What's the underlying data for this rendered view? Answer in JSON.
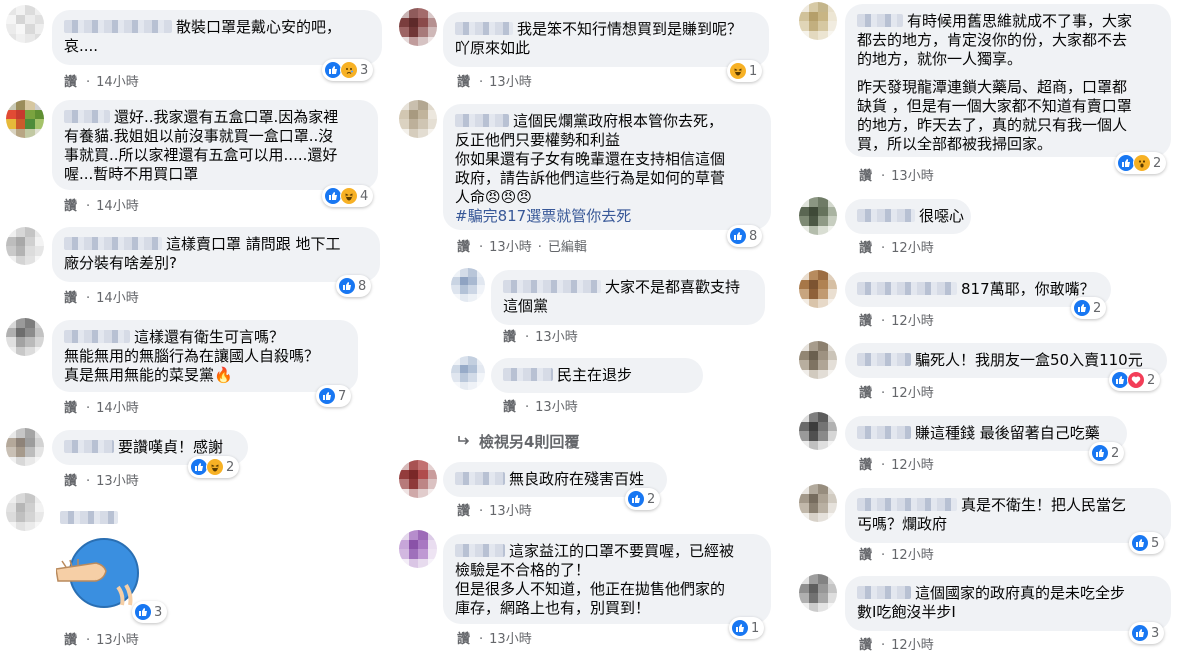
{
  "labels": {
    "like": "讚",
    "edited": "已編輯",
    "dot": "·"
  },
  "columns": [
    {
      "comments": [
        {
          "text_lines": [
            "散裝口罩是戴心安的吧，",
            "哀...."
          ],
          "time": "14小時",
          "reaction_count": "3",
          "reactions": [
            "like-icon",
            "sad-icon"
          ]
        },
        {
          "text_lines": [
            "還好..我家還有五盒口罩.因為家裡",
            "有養貓.我姐姐以前沒事就買一盒口罩..沒",
            "事就買..所以家裡還有五盒可以用.....還好",
            "喔...暫時不用買口罩"
          ],
          "time": "14小時",
          "reaction_count": "4",
          "reactions": [
            "like-icon",
            "haha-icon"
          ]
        },
        {
          "text_lines": [
            "這樣賣口罩 請問跟 地下工",
            "廠分裝有啥差別?"
          ],
          "time": "14小時",
          "reaction_count": "8",
          "reactions": [
            "like-icon"
          ]
        },
        {
          "text_lines": [
            "這樣還有衛生可言嗎？",
            "無能無用的無腦行為在讓國人自殺嗎？",
            "真是無用無能的菜旻黨🔥"
          ],
          "time": "14小時",
          "reaction_count": "7",
          "reactions": [
            "like-icon"
          ]
        },
        {
          "text_lines": [
            "要讚嘆貞！感謝"
          ],
          "time": "13小時",
          "reaction_count": "2",
          "reactions": [
            "like-icon",
            "haha-icon"
          ]
        },
        {
          "text_lines": [],
          "time": "13小時",
          "reaction_count": "3",
          "reactions": [
            "like-icon"
          ],
          "sticker": "fist-punch-sticker"
        }
      ]
    },
    {
      "comments": [
        {
          "text_lines": [
            "我是笨不知行情想買到是賺到呢？",
            "吖原來如此"
          ],
          "time": "13小時",
          "reaction_count": "1",
          "reactions": [
            "haha-icon"
          ]
        },
        {
          "text_lines": [
            "這個民爛黨政府根本管你去死，",
            "反正他們只要權勢和利益",
            "你如果還有子女有晚輩還在支持相信這個",
            "政府，請告訴他們這些行為是如何的草菅",
            "人命😠😠😠"
          ],
          "tag": "#騙完817選票就管你去死",
          "time": "13小時",
          "edited": true,
          "reaction_count": "8",
          "reactions": [
            "like-icon"
          ]
        },
        {
          "text_lines": [
            "大家不是都喜歡支持",
            "這個黨"
          ],
          "time": "13小時",
          "reply": true
        },
        {
          "text_lines": [
            "民主在退步"
          ],
          "time": "13小時",
          "reply": true
        },
        {
          "view_more": "檢視另4則回覆"
        },
        {
          "text_lines": [
            "無良政府在殘害百姓"
          ],
          "time": "13小時",
          "reaction_count": "2",
          "reactions": [
            "like-icon"
          ]
        },
        {
          "text_lines": [
            "這家益江的口罩不要買喔，已經被",
            "檢驗是不合格的了！",
            "但是很多人不知道，他正在拋售他們家的",
            "庫存，網路上也有，別買到！"
          ],
          "time": "13小時",
          "reaction_count": "1",
          "reactions": [
            "like-icon"
          ]
        }
      ]
    },
    {
      "comments": [
        {
          "text_lines": [
            "有時候用舊思維就成不了事，大家",
            "都去的地方，肯定沒你的份，大家都不去",
            "的地方，就你一人獨享。",
            "",
            "昨天發現龍潭連鎖大藥局、超商，口罩都",
            "缺貨 ，但是有一個大家都不知道有賣口罩",
            "的地方，昨天去了，真的就只有我一個人",
            "買，所以全部都被我掃回家。"
          ],
          "time": "13小時",
          "reaction_count": "2",
          "reactions": [
            "like-icon",
            "wow-icon"
          ]
        },
        {
          "text_lines": [
            "很噁心"
          ],
          "time": "12小時"
        },
        {
          "text_lines": [
            "817萬耶，你敢嘴？"
          ],
          "time": "12小時",
          "reaction_count": "2",
          "reactions": [
            "like-icon"
          ]
        },
        {
          "text_lines": [
            "騙死人！我朋友一盒50入賣110元"
          ],
          "time": "12小時",
          "reaction_count": "2",
          "reactions": [
            "like-icon",
            "love-icon"
          ]
        },
        {
          "text_lines": [
            "賺這種錢 最後留著自己吃藥"
          ],
          "time": "12小時",
          "reaction_count": "2",
          "reactions": [
            "like-icon"
          ]
        },
        {
          "text_lines": [
            "真是不衛生！把人民當乞",
            "丐嗎？爛政府"
          ],
          "time": "12小時",
          "reaction_count": "5",
          "reactions": [
            "like-icon"
          ]
        },
        {
          "text_lines": [
            "這個國家的政府真的是未吃全步",
            "數I吃飽沒半步I"
          ],
          "time": "12小時",
          "reaction_count": "3",
          "reactions": [
            "like-icon"
          ]
        }
      ]
    }
  ],
  "colors": {
    "bubble": "#f0f2f5",
    "meta": "#65676b",
    "like": "#1877f2",
    "love": "#f33e58",
    "yellow": "#f7b125",
    "link": "#385898"
  }
}
